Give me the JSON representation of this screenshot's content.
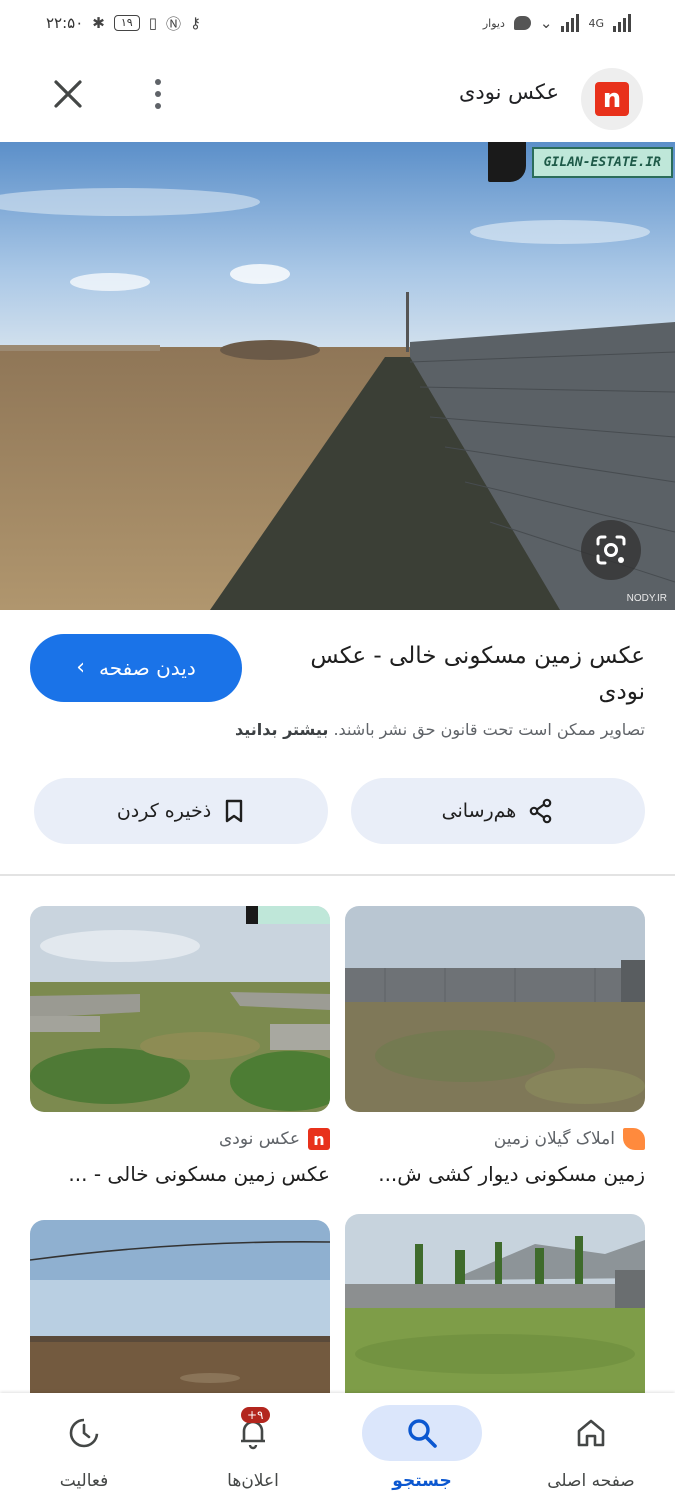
{
  "status_bar": {
    "time": "۲۲:۵۰",
    "battery": "۱۹",
    "carrier_label": "دیوار",
    "network": "4G"
  },
  "header": {
    "site_name": "عکس نودی",
    "site_badge_letter": "n"
  },
  "hero": {
    "watermark_text": "GILAN-ESTATE.IR",
    "corner_mark": "NODY.IR"
  },
  "info": {
    "title": "عکس زمین مسکونی خالی - عکس نودی",
    "visit_button": "دیدن صفحه",
    "notice_text": "تصاویر ممکن است تحت قانون حق نشر باشند.",
    "notice_link": "بیشتر بدانید",
    "share_button": "هم‌رسانی",
    "save_button": "ذخیره کردن"
  },
  "results": [
    {
      "source": "املاک گیلان زمین",
      "title": "زمین مسکونی دیوار کشی ش..."
    },
    {
      "source": "عکس نودی",
      "source_badge_letter": "n",
      "title": "عکس زمین مسکونی خالی - ..."
    }
  ],
  "bottom_nav": {
    "home": "صفحه اصلی",
    "search": "جستجو",
    "notifications": "اعلان‌ها",
    "notifications_badge": "+۹",
    "activity": "فعالیت"
  },
  "colors": {
    "accent": "#1a73e8",
    "badge_red": "#e8311b",
    "action_bg": "#e9eef8",
    "nav_active_bg": "#dbe6fb"
  }
}
